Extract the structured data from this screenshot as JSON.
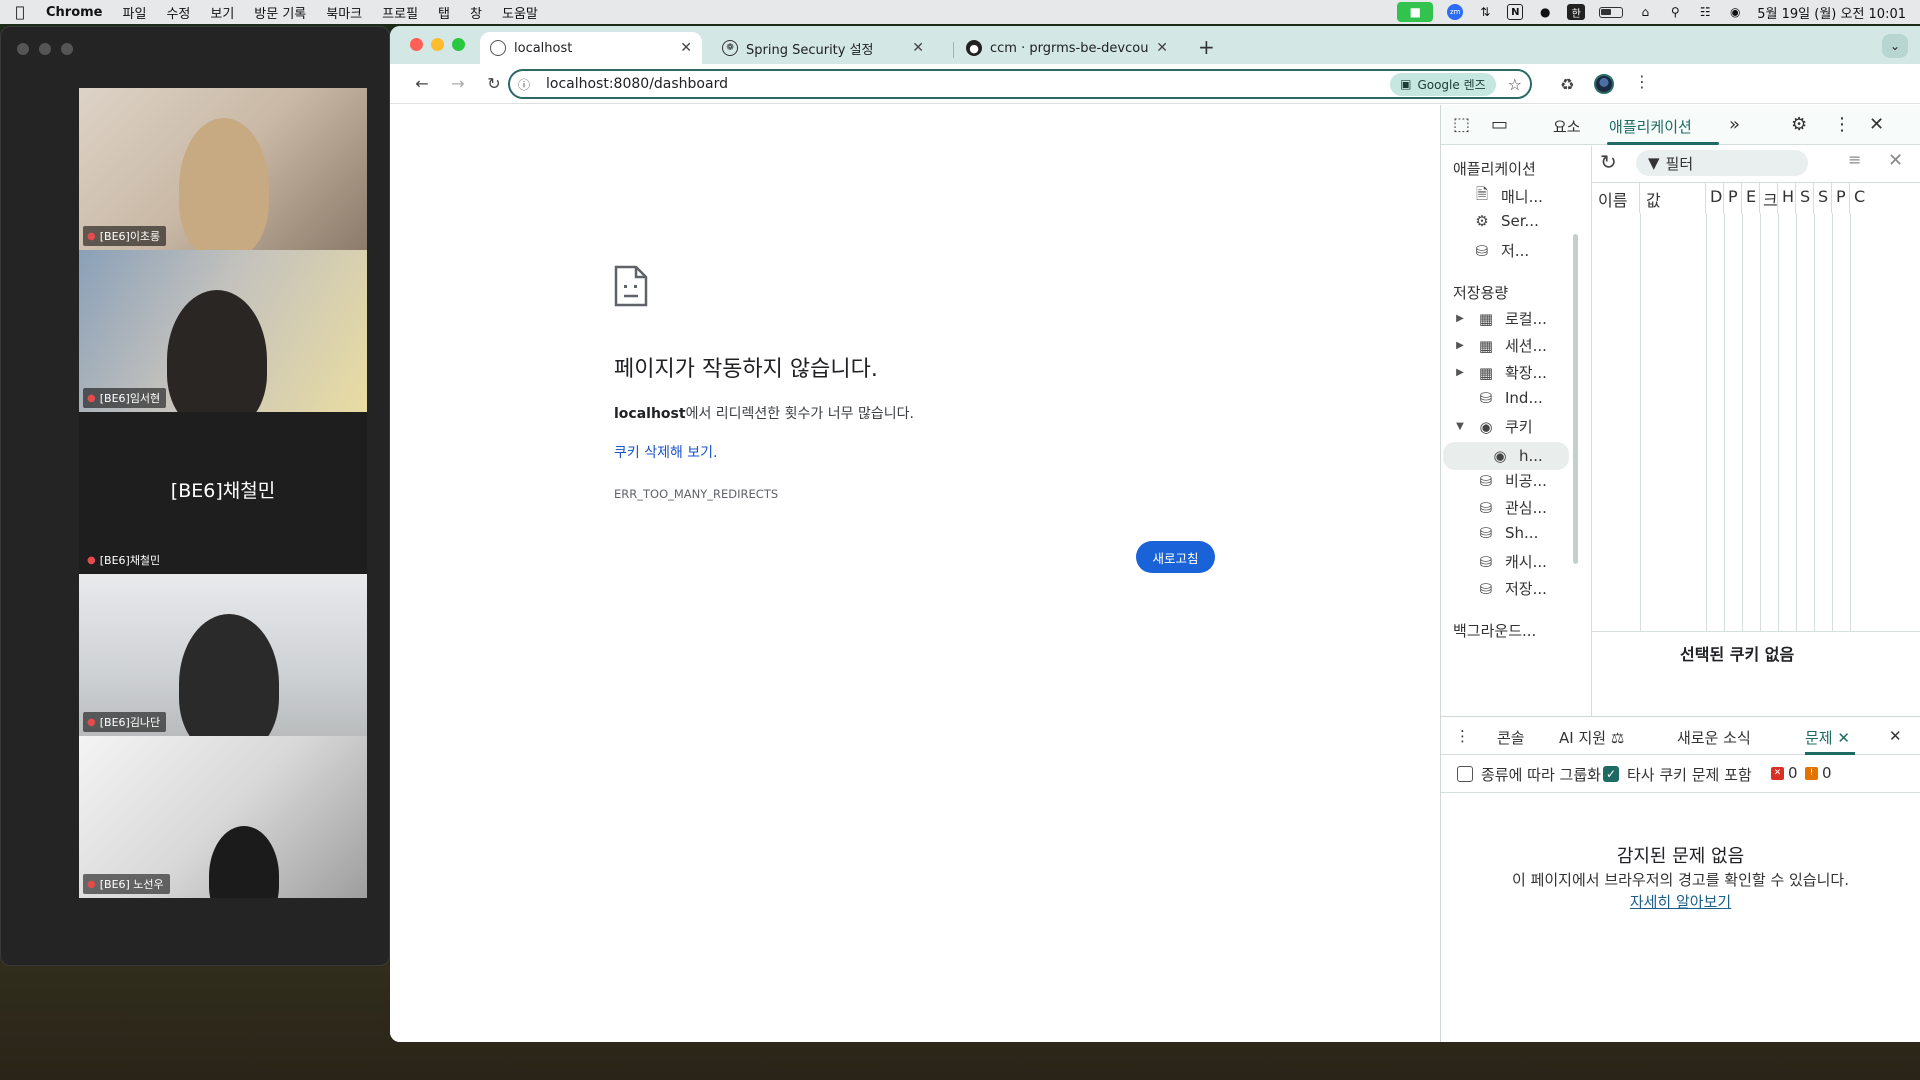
{
  "menubar": {
    "app": "Chrome",
    "items": [
      "파일",
      "수정",
      "보기",
      "방문 기록",
      "북마크",
      "프로필",
      "탭",
      "창",
      "도움말"
    ],
    "tray": {
      "zoom": "zm",
      "notion": "N",
      "han": "한"
    },
    "clock": "5월 19일 (월) 오전 10:01"
  },
  "zoom": {
    "participants": [
      {
        "name": "[BE6]이초롱"
      },
      {
        "name": "[BE6]임서현"
      },
      {
        "name": "[BE6]채철민",
        "big_name": "[BE6]채철민"
      },
      {
        "name": "[BE6]김나단"
      },
      {
        "name": "[BE6] 노선우"
      }
    ]
  },
  "tabs": [
    {
      "title": "localhost",
      "active": true,
      "icon": "globe-icon"
    },
    {
      "title": "Spring Security 설정",
      "active": false,
      "icon": "openai-icon"
    },
    {
      "title": "ccm · prgrms-be-devcourse/",
      "active": false,
      "icon": "github-icon"
    }
  ],
  "omnibox": {
    "url": "localhost:8080/dashboard",
    "lens_label": "Google 렌즈"
  },
  "error_page": {
    "title": "페이지가 작동하지 않습니다.",
    "host": "localhost",
    "desc_rest": "에서 리디렉션한 횟수가 너무 많습니다.",
    "link": "쿠키 삭제해 보기.",
    "code": "ERR_TOO_MANY_REDIRECTS",
    "reload": "새로고침"
  },
  "devtools": {
    "tabs": {
      "elements": "요소",
      "application": "애플리케이션"
    },
    "sidebar": {
      "app_section": "애플리케이션",
      "app_items": [
        "매니...",
        "Ser...",
        "저..."
      ],
      "storage_section": "저장용량",
      "storage_items": [
        "로컬...",
        "세션...",
        "확장...",
        "Ind...",
        "쿠키",
        "h...",
        "비공...",
        "관심...",
        "Sh...",
        "캐시...",
        "저장..."
      ],
      "background_section": "백그라운드..."
    },
    "filter_placeholder": "필터",
    "columns": [
      "이름",
      "값",
      "D",
      "P",
      "E",
      "크",
      "H",
      "S",
      "S",
      "P",
      "C"
    ],
    "no_cookie": "선택된 쿠키 없음",
    "drawer": {
      "tabs": {
        "console": "콘솔",
        "ai": "AI 지원",
        "news": "새로운 소식",
        "issues": "문제"
      },
      "group_by_kind": "종류에 따라 그룹화",
      "third_party": "타사 쿠키 문제 포함",
      "error_count": "0",
      "warning_count": "0",
      "empty_title": "감지된 문제 없음",
      "empty_desc": "이 페이지에서 브라우저의 경고를 확인할 수 있습니다.",
      "learn_more": "자세히 알아보기"
    }
  },
  "colors": {
    "accent": "#1d6b63",
    "tabstrip": "#d3e8e5",
    "link": "#1a55c8",
    "reload_button": "#1a62d8"
  }
}
